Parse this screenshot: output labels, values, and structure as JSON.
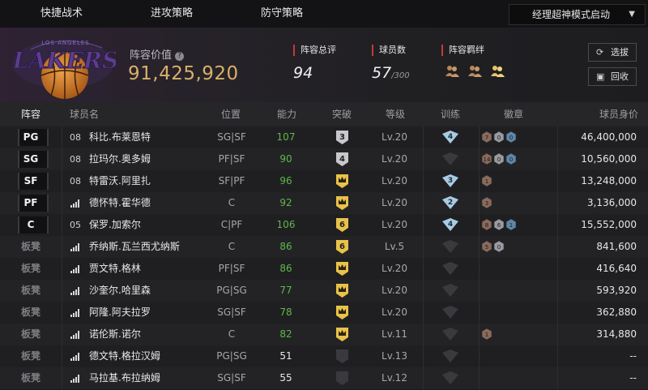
{
  "topnav": {
    "tabs": [
      "快捷战术",
      "进攻策略",
      "防守策略"
    ],
    "mode_dropdown": "经理超神模式启动"
  },
  "team": {
    "logo_text": "LAKERS",
    "logo_arc_text": "LOS ANGELES",
    "value_label": "阵容价值",
    "value": "91,425,920",
    "rating_label": "阵容总评",
    "rating": "94",
    "players_label": "球员数",
    "players": "57",
    "players_max": "/300",
    "bond_label": "阵容羁绊",
    "buttons": {
      "select": "选拔",
      "recycle": "回收"
    }
  },
  "columns": [
    "阵容",
    "球员名",
    "位置",
    "能力",
    "突破",
    "等级",
    "训练",
    "徽章",
    "球员身价"
  ],
  "rows": [
    {
      "slot": "PG",
      "starter": true,
      "num": "08",
      "name": "科比.布莱恩特",
      "pos": "SG|SF",
      "ability": "107",
      "ability_color": "green",
      "bt": "3",
      "bt_type": "num",
      "level": "Lv.20",
      "train": "4",
      "badges": [
        "7",
        "0",
        "0"
      ],
      "badge_types": [
        "bronze",
        "silver",
        "blue"
      ],
      "value": "46,400,000"
    },
    {
      "slot": "SG",
      "starter": true,
      "num": "08",
      "name": "拉玛尔.奥多姆",
      "pos": "PF|SF",
      "ability": "90",
      "ability_color": "green",
      "bt": "4",
      "bt_type": "num",
      "level": "Lv.20",
      "train": "",
      "badges": [
        "14",
        "0",
        "0"
      ],
      "badge_types": [
        "bronze",
        "silver",
        "blue"
      ],
      "value": "10,560,000"
    },
    {
      "slot": "SF",
      "starter": true,
      "num": "08",
      "name": "特雷沃.阿里扎",
      "pos": "SF|PF",
      "ability": "96",
      "ability_color": "green",
      "bt": "crown",
      "bt_type": "crown",
      "level": "Lv.20",
      "train": "3",
      "badges": [
        "1"
      ],
      "badge_types": [
        "bronze"
      ],
      "value": "13,248,000"
    },
    {
      "slot": "PF",
      "starter": true,
      "num": "",
      "name": "德怀特.霍华德",
      "pos": "C",
      "ability": "92",
      "ability_color": "green",
      "bt": "crown",
      "bt_type": "crown",
      "level": "Lv.20",
      "train": "2",
      "badges": [
        "3"
      ],
      "badge_types": [
        "bronze"
      ],
      "value": "3,136,000"
    },
    {
      "slot": "C",
      "starter": true,
      "num": "05",
      "name": "保罗.加索尔",
      "pos": "C|PF",
      "ability": "106",
      "ability_color": "green",
      "bt": "6",
      "bt_type": "num-gold",
      "level": "Lv.20",
      "train": "4",
      "badges": [
        "8",
        "6",
        "1"
      ],
      "badge_types": [
        "bronze",
        "silver",
        "blue"
      ],
      "value": "15,552,000"
    },
    {
      "slot": "板凳",
      "starter": false,
      "num": "",
      "name": "乔纳斯.瓦兰西尤纳斯",
      "pos": "C",
      "ability": "86",
      "ability_color": "green",
      "bt": "6",
      "bt_type": "num-gold",
      "level": "Lv.5",
      "train": "",
      "badges": [
        "5",
        "0"
      ],
      "badge_types": [
        "bronze",
        "silver"
      ],
      "value": "841,600"
    },
    {
      "slot": "板凳",
      "starter": false,
      "num": "",
      "name": "贾文特.格林",
      "pos": "PF|SF",
      "ability": "86",
      "ability_color": "green",
      "bt": "crown",
      "bt_type": "crown",
      "level": "Lv.20",
      "train": "",
      "badges": [],
      "badge_types": [],
      "value": "416,640"
    },
    {
      "slot": "板凳",
      "starter": false,
      "num": "",
      "name": "沙奎尔.哈里森",
      "pos": "PG|SG",
      "ability": "77",
      "ability_color": "green",
      "bt": "crown",
      "bt_type": "crown",
      "level": "Lv.20",
      "train": "",
      "badges": [],
      "badge_types": [],
      "value": "593,920"
    },
    {
      "slot": "板凳",
      "starter": false,
      "num": "",
      "name": "阿隆.阿夫拉罗",
      "pos": "SG|SF",
      "ability": "78",
      "ability_color": "green",
      "bt": "crown",
      "bt_type": "crown",
      "level": "Lv.20",
      "train": "",
      "badges": [],
      "badge_types": [],
      "value": "362,880"
    },
    {
      "slot": "板凳",
      "starter": false,
      "num": "",
      "name": "诺伦斯.诺尔",
      "pos": "C",
      "ability": "82",
      "ability_color": "green",
      "bt": "crown",
      "bt_type": "crown",
      "level": "Lv.11",
      "train": "",
      "badges": [
        "1"
      ],
      "badge_types": [
        "bronze"
      ],
      "value": "314,880"
    },
    {
      "slot": "板凳",
      "starter": false,
      "num": "",
      "name": "德文特.格拉汉姆",
      "pos": "PG|SG",
      "ability": "51",
      "ability_color": "white",
      "bt": "",
      "bt_type": "empty",
      "level": "Lv.13",
      "train": "",
      "badges": [],
      "badge_types": [],
      "value": "--"
    },
    {
      "slot": "板凳",
      "starter": false,
      "num": "",
      "name": "马拉基.布拉纳姆",
      "pos": "SG|SF",
      "ability": "55",
      "ability_color": "white",
      "bt": "",
      "bt_type": "empty",
      "level": "Lv.12",
      "train": "",
      "badges": [],
      "badge_types": [],
      "value": "--"
    }
  ],
  "colors": {
    "gold": "#d9b06a",
    "green": "#5fb84a",
    "accent_red": "#c53a3a",
    "train_blue": "#a9cbe3"
  }
}
